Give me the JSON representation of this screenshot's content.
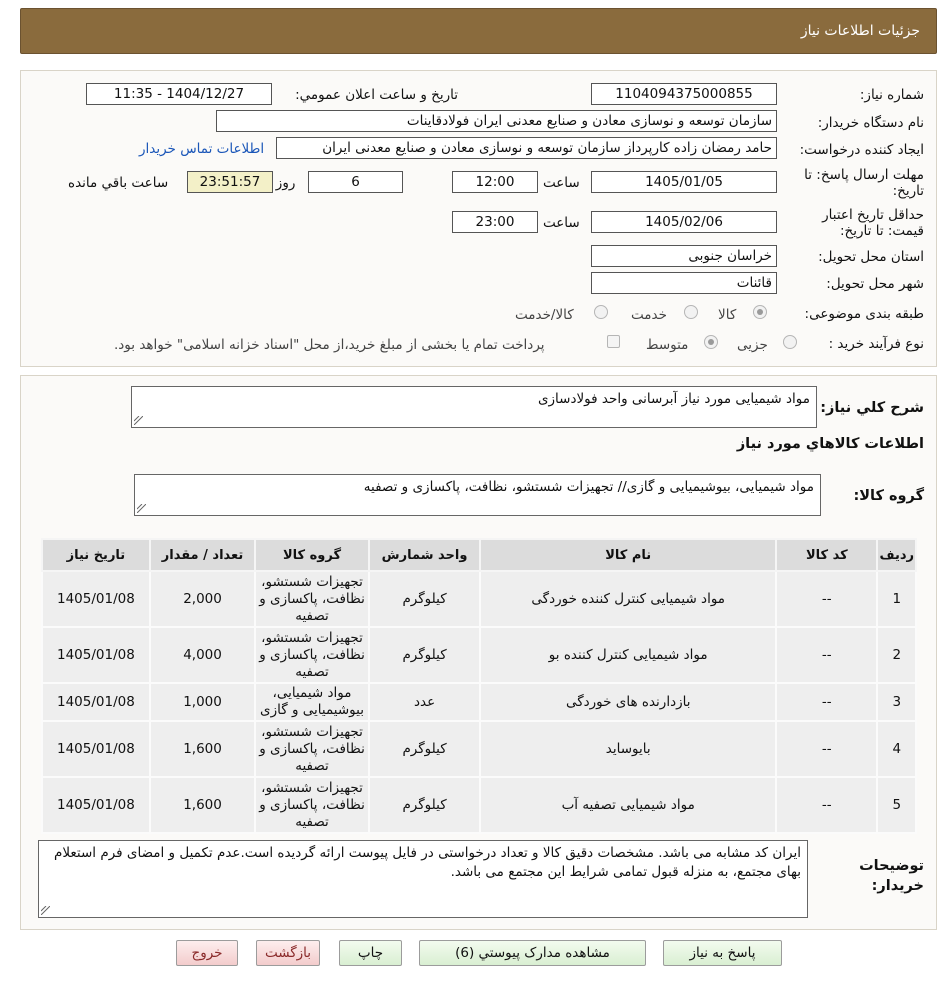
{
  "header": {
    "title": "جزئیات اطلاعات نیاز"
  },
  "watermark": {
    "text": "AriaTender.net"
  },
  "form": {
    "need_number_label": "شماره نیاز:",
    "need_number": "1104094375000855",
    "announce_label": "تاریخ و ساعت اعلان عمومي:",
    "announce_value": "1404/12/27 - 11:35",
    "buyer_org_label": "نام دستگاه خریدار:",
    "buyer_org": "سازمان توسعه و نوسازی معادن و صنایع معدنی ایران فولادقاینات",
    "requester_label": "ایجاد کننده درخواست:",
    "requester": "حامد  رمضان زاده  کارپرداز  سازمان توسعه و نوسازی معادن و صنایع معدنی ایران",
    "contact_link": "اطلاعات تماس خریدار",
    "deadline_label_1": "مهلت ارسال پاسخ: تا",
    "deadline_label_2": "تاریخ:",
    "deadline_date": "1405/01/05",
    "time_label": "ساعت",
    "deadline_time": "12:00",
    "days_value": "6",
    "days_label": "روز و",
    "remaining_time": "23:51:57",
    "remaining_label": "ساعت باقي مانده",
    "validity_label_1": "حداقل تاریخ اعتبار",
    "validity_label_2": "قیمت: تا تاریخ:",
    "validity_date": "1405/02/06",
    "validity_time": "23:00",
    "province_label": "استان محل تحویل:",
    "province": "خراسان جنوبی",
    "city_label": "شهر محل تحویل:",
    "city": "قائنات",
    "category_label": "طبقه بندی موضوعی:",
    "category_options": [
      "کالا",
      "خدمت",
      "کالا/خدمت"
    ],
    "category_selected": "کالا",
    "purchase_type_label": "نوع فرآیند خرید :",
    "purchase_options": [
      "جزیی",
      "متوسط"
    ],
    "purchase_selected": "متوسط",
    "payment_note": "پرداخت تمام یا بخشی از مبلغ خرید،از محل \"اسناد خزانه اسلامی\" خواهد بود."
  },
  "details": {
    "summary_label": "شرح کلي نیاز:",
    "summary": "مواد شیمیایی مورد نیاز آبرسانی واحد فولادسازی",
    "items_heading": "اطلاعات کالاهاي مورد نیاز",
    "group_label": "گروه کالا:",
    "group_value": "مواد شیمیایی، بیوشیمیایی و  گازی// تجهیزات شستشو، نظافت، پاکسازی و تصفیه",
    "table": {
      "headers": [
        "ردیف",
        "کد کالا",
        "نام کالا",
        "واحد شمارش",
        "گروه کالا",
        "تعداد / مقدار",
        "تاریخ نیاز"
      ],
      "rows": [
        [
          "1",
          "--",
          "مواد شیمیایی کنترل کننده خوردگی",
          "کیلوگرم",
          "تجهیزات شستشو، نظافت، پاکسازی و تصفیه",
          "2,000",
          "1405/01/08"
        ],
        [
          "2",
          "--",
          "مواد شیمیایی کنترل کننده بو",
          "کیلوگرم",
          "تجهیزات شستشو، نظافت، پاکسازی و تصفیه",
          "4,000",
          "1405/01/08"
        ],
        [
          "3",
          "--",
          "بازدارنده های خوردگی",
          "عدد",
          "مواد شیمیایی، بیوشیمیایی و گازی",
          "1,000",
          "1405/01/08"
        ],
        [
          "4",
          "--",
          "بایوساید",
          "کیلوگرم",
          "تجهیزات شستشو، نظافت، پاکسازی و تصفیه",
          "1,600",
          "1405/01/08"
        ],
        [
          "5",
          "--",
          "مواد شیمیایی تصفیه آب",
          "کیلوگرم",
          "تجهیزات شستشو، نظافت، پاکسازی و تصفیه",
          "1,600",
          "1405/01/08"
        ]
      ]
    },
    "buyer_notes_label_1": "توضیحات",
    "buyer_notes_label_2": "خریدار:",
    "buyer_notes": "ایران کد مشابه می باشد. مشخصات دقیق کالا و تعداد درخواستی در فایل پیوست ارائه گردیده است.عدم تکمیل و امضای فرم استعلام بهای مجتمع، به منزله قبول تمامی شرایط این مجتمع می باشد."
  },
  "buttons": {
    "reply": "پاسخ به نیاز",
    "attachments": "مشاهده مدارک پیوستي (6)",
    "print": "چاپ",
    "back": "بازگشت",
    "exit": "خروج"
  },
  "colors": {
    "header_bg": "#8a6b3d",
    "link": "#1a56b8",
    "button_green": "#d9efd2",
    "button_red": "#f3cccc"
  }
}
